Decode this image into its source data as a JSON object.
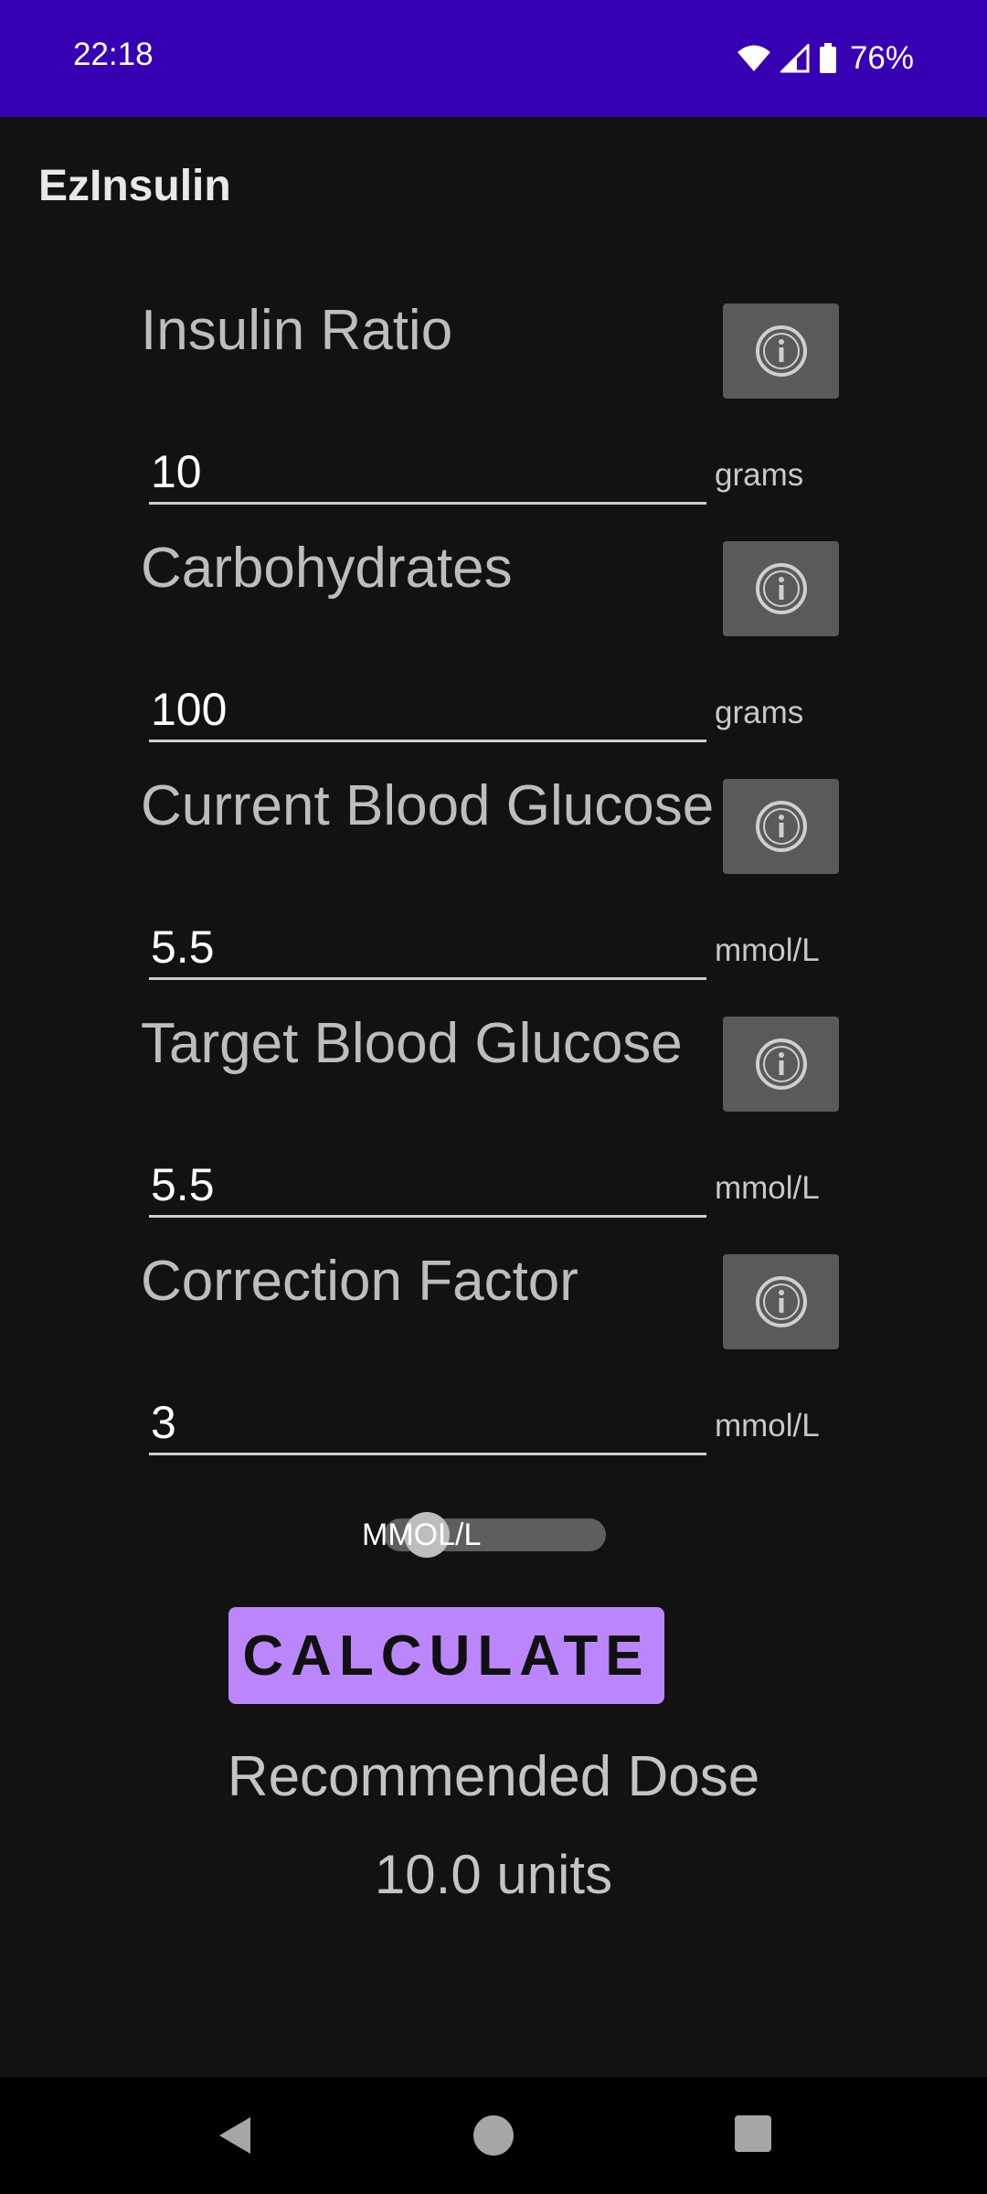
{
  "status_bar": {
    "time": "22:18",
    "battery": "76%",
    "icons": [
      "wifi-icon",
      "signal-icon",
      "battery-icon"
    ]
  },
  "app": {
    "title": "EzInsulin"
  },
  "fields": [
    {
      "label": "Insulin Ratio",
      "value": "10",
      "unit": "grams"
    },
    {
      "label": "Carbohydrates",
      "value": "100",
      "unit": "grams"
    },
    {
      "label": "Current Blood Glucose",
      "value": "5.5",
      "unit": "mmol/L"
    },
    {
      "label": "Target Blood Glucose",
      "value": "5.5",
      "unit": "mmol/L"
    },
    {
      "label": "Correction Factor",
      "value": "3",
      "unit": "mmol/L"
    }
  ],
  "unit_toggle": {
    "label": "MMOL/L"
  },
  "actions": {
    "calculate_label": "CALCULATE"
  },
  "result": {
    "title": "Recommended Dose",
    "value": "10.0 units"
  },
  "colors": {
    "status_bar": "#3700b3",
    "background": "#121212",
    "accent": "#bb86fc",
    "info_button": "#5a5a5a"
  },
  "nav": {
    "icons": [
      "back-icon",
      "home-icon",
      "recents-icon"
    ]
  }
}
